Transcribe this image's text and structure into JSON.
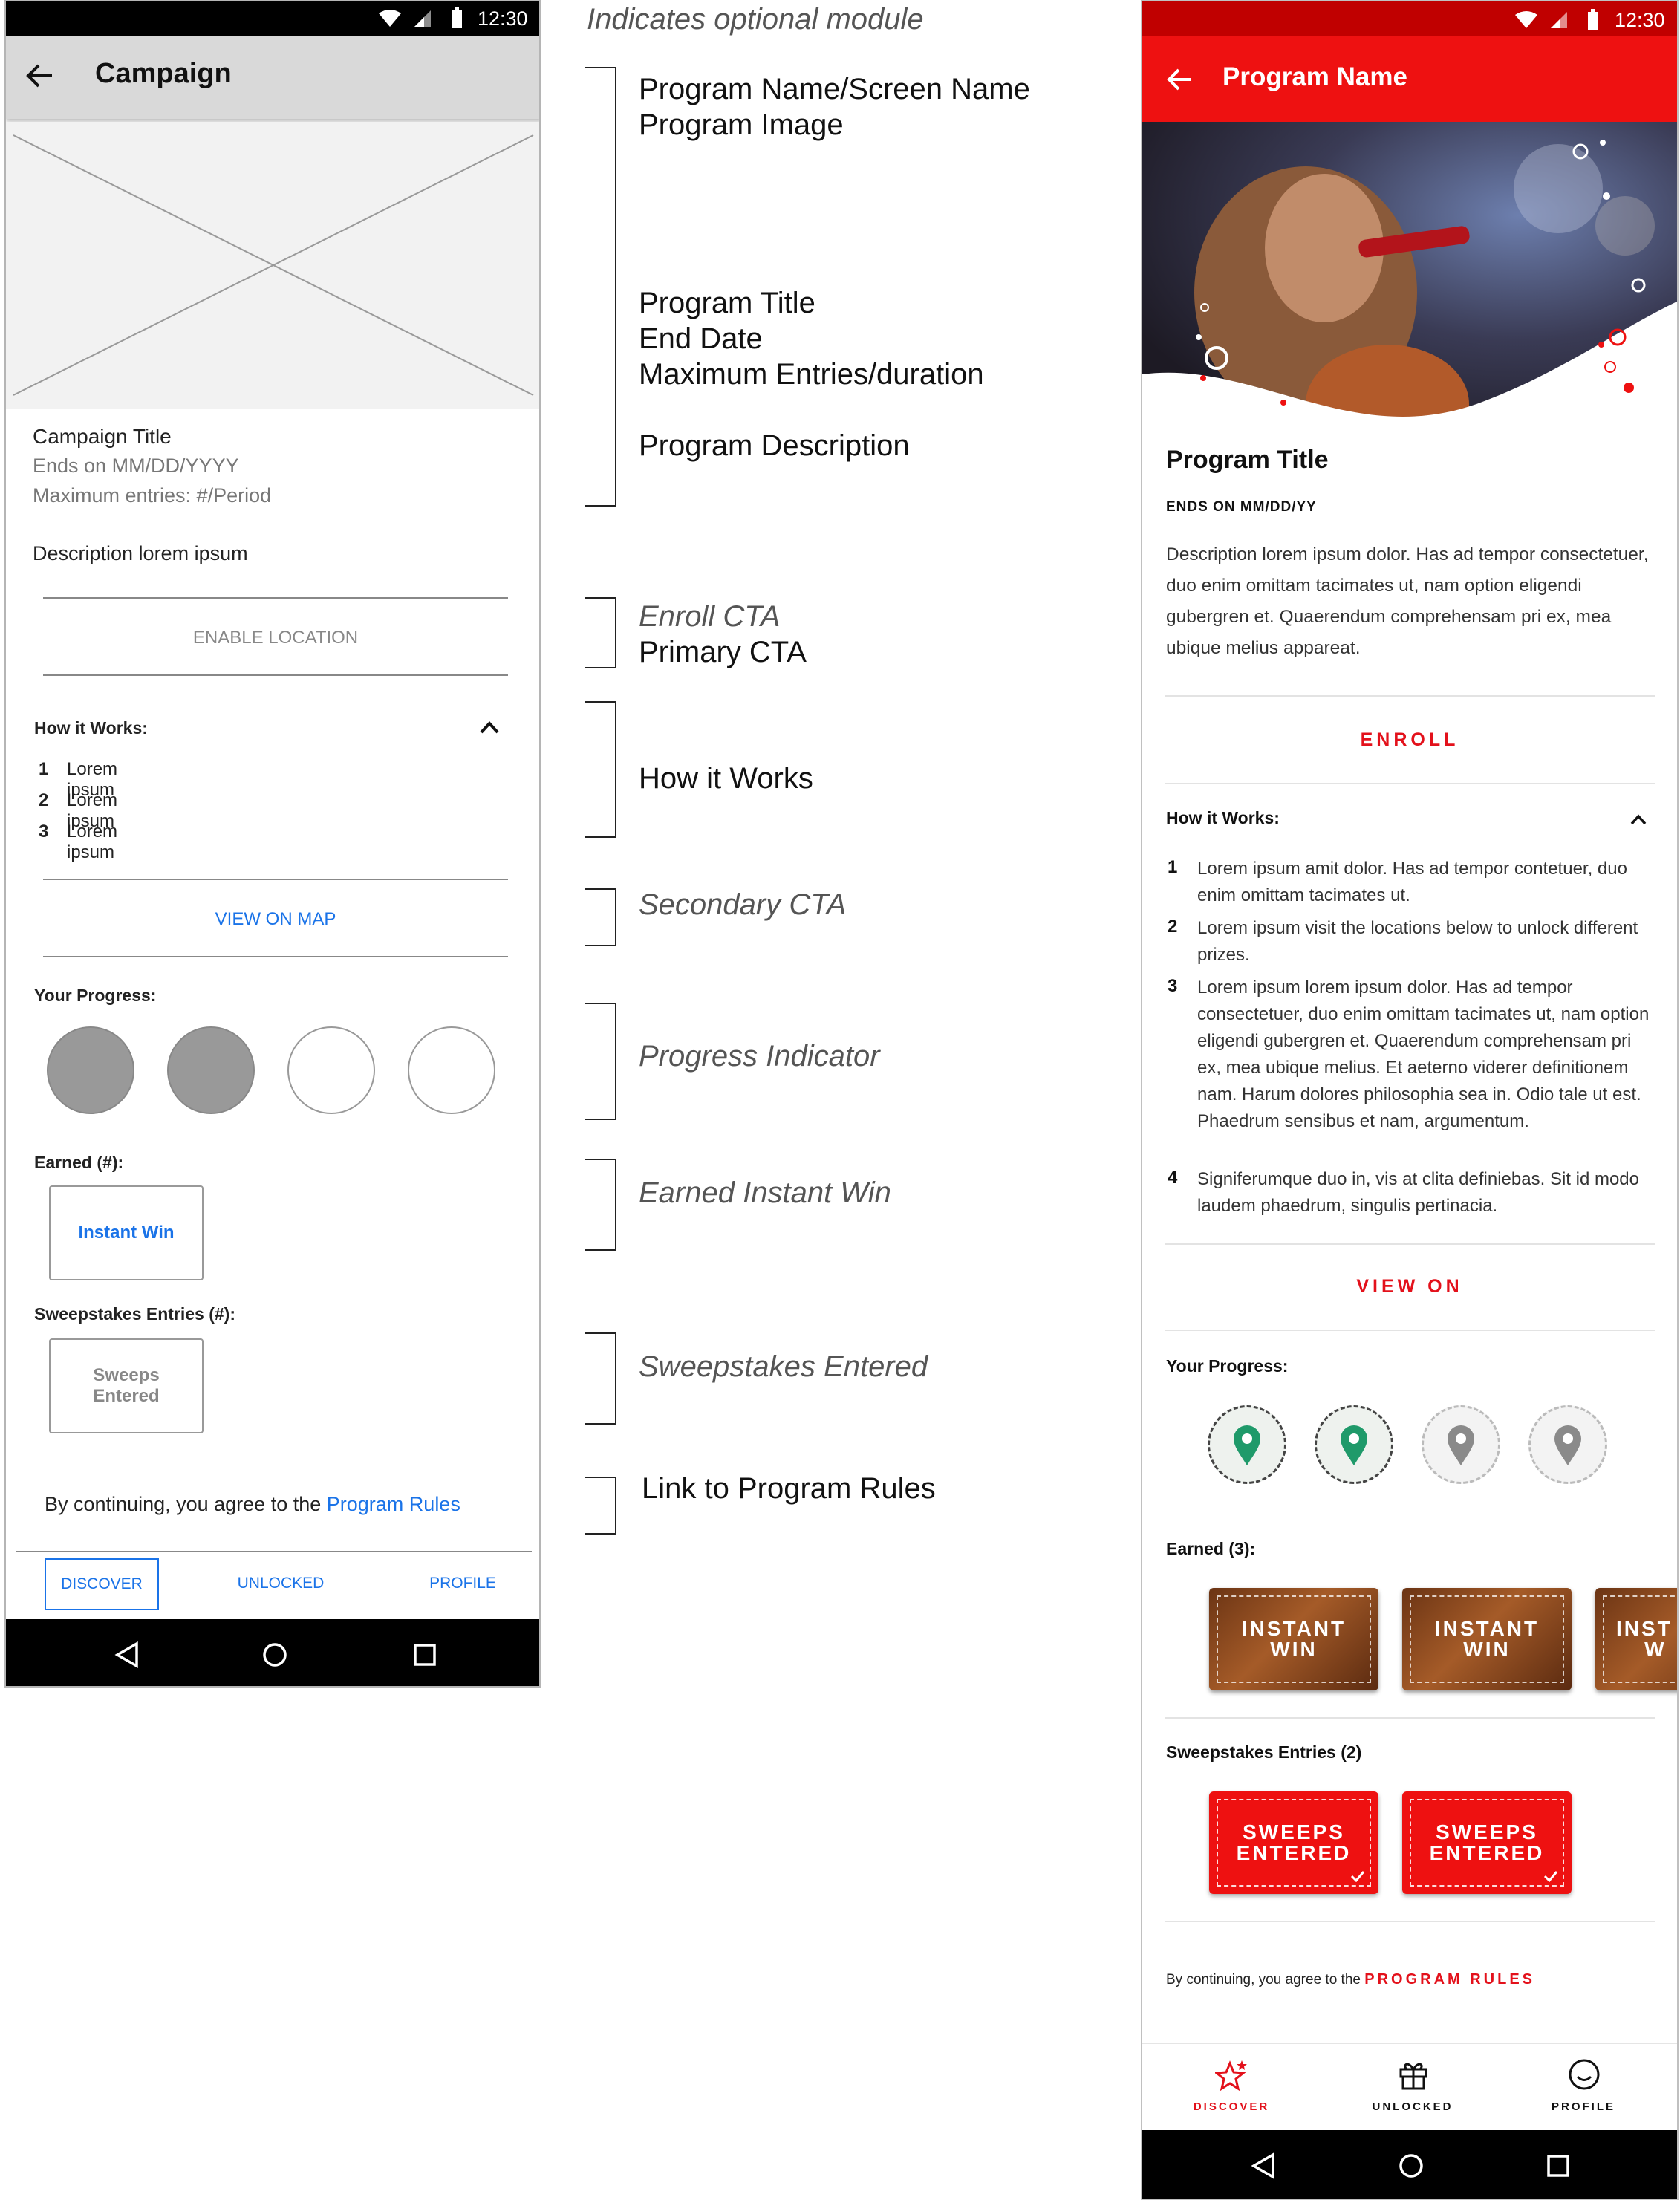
{
  "status": {
    "time": "12:30"
  },
  "wireframe": {
    "title": "Campaign",
    "campaign_title": "Campaign Title",
    "ends_on": "Ends on  MM/DD/YYYY",
    "max_entries": "Maximum entries: #/Period",
    "description": "Description lorem ipsum",
    "enable_location": "ENABLE LOCATION",
    "how_it_works": "How it Works:",
    "steps": [
      {
        "num": "1",
        "text": "Lorem ipsum"
      },
      {
        "num": "2",
        "text": "Lorem ipsum"
      },
      {
        "num": "3",
        "text": "Lorem ipsum"
      }
    ],
    "view_on_map": "VIEW ON MAP",
    "your_progress": "Your Progress:",
    "progress": {
      "filled": 2,
      "total": 4
    },
    "earned": "Earned (#):",
    "instant_win": "Instant Win",
    "sweepstakes_entries": "Sweepstakes Entries (#):",
    "sweeps_entered": "Sweeps Entered",
    "agree_prefix": "By continuing, you agree to the ",
    "program_rules": "Program Rules",
    "tabs": [
      "DISCOVER",
      "UNLOCKED",
      "PROFILE"
    ]
  },
  "annotations": {
    "legend": "Indicates optional module",
    "program_name": "Program Name/Screen Name",
    "program_image": "Program Image",
    "program_title": "Program Title",
    "end_date": "End Date",
    "max_entries": "Maximum Entries/duration",
    "program_description": "Program Description",
    "enroll_cta": "Enroll CTA",
    "primary_cta": "Primary CTA",
    "how_it_works": "How it Works",
    "secondary_cta": "Secondary CTA",
    "progress_indicator": "Progress Indicator",
    "earned_instant_win": "Earned Instant Win",
    "sweepstakes_entered": "Sweepstakes Entered",
    "link_rules": "Link to Program Rules"
  },
  "hifi": {
    "title": "Program Name",
    "program_title": "Program Title",
    "ends_on": "ENDS ON MM/DD/YY",
    "description": "Description lorem ipsum dolor. Has ad tempor consectetuer, duo enim omittam tacimates ut, nam option eligendi gubergren et. Quaerendum comprehensam pri ex, mea ubique melius appareat.",
    "enroll": "ENROLL",
    "how_it_works": "How it Works:",
    "steps": [
      {
        "num": "1",
        "text": "Lorem ipsum amit dolor. Has ad tempor contetuer, duo enim omittam tacimates ut."
      },
      {
        "num": "2",
        "text": "Lorem ipsum visit the locations below to unlock different prizes."
      },
      {
        "num": "3",
        "text": "Lorem ipsum lorem ipsum dolor. Has ad tempor consectetuer, duo enim omittam tacimates ut, nam option eligendi gubergren et. Quaerendum comprehensam pri ex, mea ubique melius. Et aeterno viderer definitionem nam. Harum dolores philosophia sea in. Odio tale ut est. Phaedrum sensibus et nam, argumentum."
      },
      {
        "num": "4",
        "text": "Signiferumque duo in, vis at clita definiebas. Sit id modo laudem phaedrum, singulis pertinacia."
      }
    ],
    "view_on": "VIEW ON",
    "your_progress": "Your Progress:",
    "progress": {
      "unlocked": 2,
      "total": 4
    },
    "earned": "Earned (3):",
    "instant_win_line1": "INSTANT",
    "instant_win_line2": "WIN",
    "instant_win_partial_line1": "INST",
    "instant_win_partial_line2": "W",
    "sweepstakes_entries": "Sweepstakes Entries (2)",
    "sweeps_line1": "SWEEPS",
    "sweeps_line2": "ENTERED",
    "agree_prefix": "By continuing, you agree to the ",
    "program_rules": "PROGRAM RULES",
    "tabs": [
      "DISCOVER",
      "UNLOCKED",
      "PROFILE"
    ],
    "colors": {
      "brand_red": "#ee1111",
      "pin_green": "#1f9a6a"
    }
  }
}
